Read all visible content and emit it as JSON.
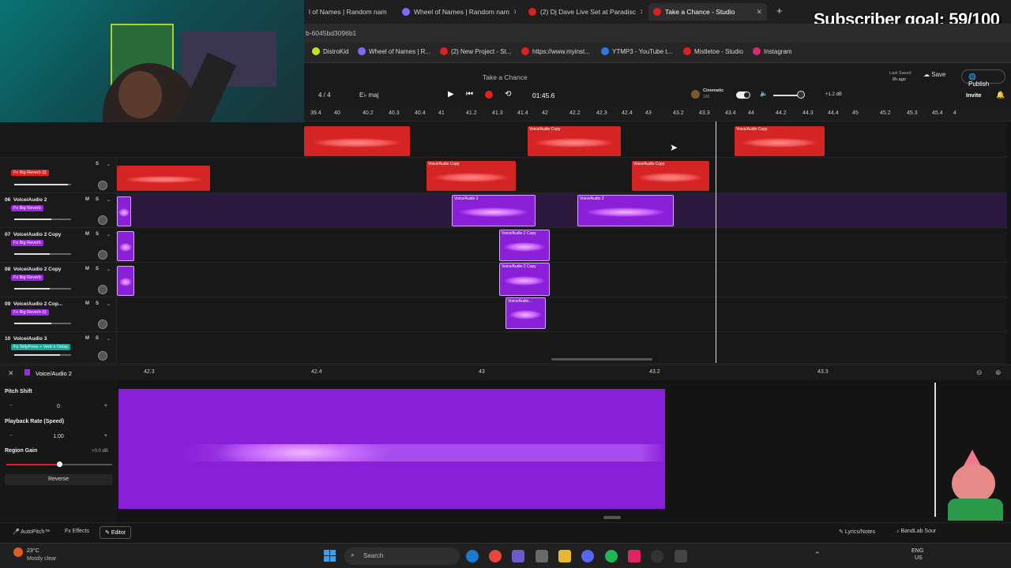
{
  "overlay": {
    "subscriber_goal": "Subscriber goal: 59/100"
  },
  "browser": {
    "tabs": [
      {
        "label": "l of Names | Random nam",
        "color": "#4a90e2"
      },
      {
        "label": "Wheel of Names | Random nam",
        "color": "#7b6cff"
      },
      {
        "label": "(2) Dj Dave Live Set at Paradisc",
        "color": "#e02020"
      },
      {
        "label": "Take a Chance - Studio",
        "color": "#e02020"
      }
    ],
    "url": "b-6045bd3096b1",
    "bookmarks": [
      {
        "label": "DistroKid",
        "color": "#c8e020"
      },
      {
        "label": "Wheel of Names | R...",
        "color": "#7b6cff"
      },
      {
        "label": "(2) New Project - St...",
        "color": "#e02020"
      },
      {
        "label": "https://www.myinst...",
        "color": "#e02020"
      },
      {
        "label": "YTMP3 - YouTube t...",
        "color": "#2a7be4"
      },
      {
        "label": "Mistletoe - Studio",
        "color": "#e02020"
      },
      {
        "label": "Instagram",
        "color": "#d62976"
      }
    ]
  },
  "app": {
    "project_title": "Take a Chance",
    "last_saved": "Last Saved",
    "last_saved_time": "6h ago",
    "save_label": "Save",
    "publish_label": "Publish",
    "invite_label": "Invite",
    "time_signature": "4 / 4",
    "key": "E♭ maj",
    "position": "01:45.6",
    "cinematic_label": "Cinematic",
    "cinematic_value": "100",
    "master_db": "+1.2 dB"
  },
  "ruler_ticks": [
    "39.4",
    "40",
    "40.2",
    "40.3",
    "40.4",
    "41",
    "41.2",
    "41.3",
    "41.4",
    "42",
    "42.2",
    "42.3",
    "42.4",
    "43",
    "43.2",
    "43.3",
    "43.4",
    "44",
    "44.2",
    "44.3",
    "44.4",
    "45",
    "45.2",
    "45.3",
    "45.4",
    "4"
  ],
  "tracks": [
    {
      "num": "",
      "name": "",
      "fx": "Fx Big Reverb (I)",
      "fx_color": "#e02020",
      "clip_label": "Voice/Audio Copy"
    },
    {
      "num": "06",
      "name": "Voice/Audio 2",
      "fx": "Fx Big Reverb",
      "fx_color": "#9a2ae0",
      "clip_label": "Voice/Audio 2"
    },
    {
      "num": "07",
      "name": "Voice/Audio 2 Copy",
      "fx": "Fx Big Reverb",
      "fx_color": "#9a2ae0",
      "clip_label": "Voice/Audio 2 Copy"
    },
    {
      "num": "08",
      "name": "Voice/Audio 2 Copy",
      "fx": "Fx Big Reverb",
      "fx_color": "#9a2ae0",
      "clip_label": "Voice/Audio 2 Copy"
    },
    {
      "num": "09",
      "name": "Voice/Audio 2 Cop...",
      "fx": "Fx Big Reverb (I)",
      "fx_color": "#9a2ae0",
      "clip_label": "Voice/Audio..."
    },
    {
      "num": "10",
      "name": "Voice/Audio 3",
      "fx": "Fx TellyPone + Verb n Delay",
      "fx_color": "#1aa89a",
      "clip_label": ""
    }
  ],
  "track_buttons": {
    "mute": "M",
    "solo": "S"
  },
  "editor": {
    "track_name": "Voice/Audio 2",
    "ruler_ticks": [
      "42.3",
      "42.4",
      "43",
      "43.2",
      "43.3"
    ],
    "pitch_shift_label": "Pitch Shift",
    "pitch_shift_value": "0",
    "playback_rate_label": "Playback Rate (Speed)",
    "playback_rate_value": "1.00",
    "region_gain_label": "Region Gain",
    "region_gain_value": "+0.0 dB",
    "reverse_label": "Reverse",
    "minus": "−",
    "plus": "+"
  },
  "footer": {
    "autopitch_label": "AutoPitch™",
    "effects_label": "Effects",
    "editor_label": "Editor",
    "lyrics_label": "Lyrics/Notes",
    "bandlab_label": "BandLab Sour"
  },
  "taskbar": {
    "weather_temp": "23°C",
    "weather_desc": "Mostly clear",
    "search_placeholder": "Search",
    "lang": "ENG",
    "region": "US"
  }
}
